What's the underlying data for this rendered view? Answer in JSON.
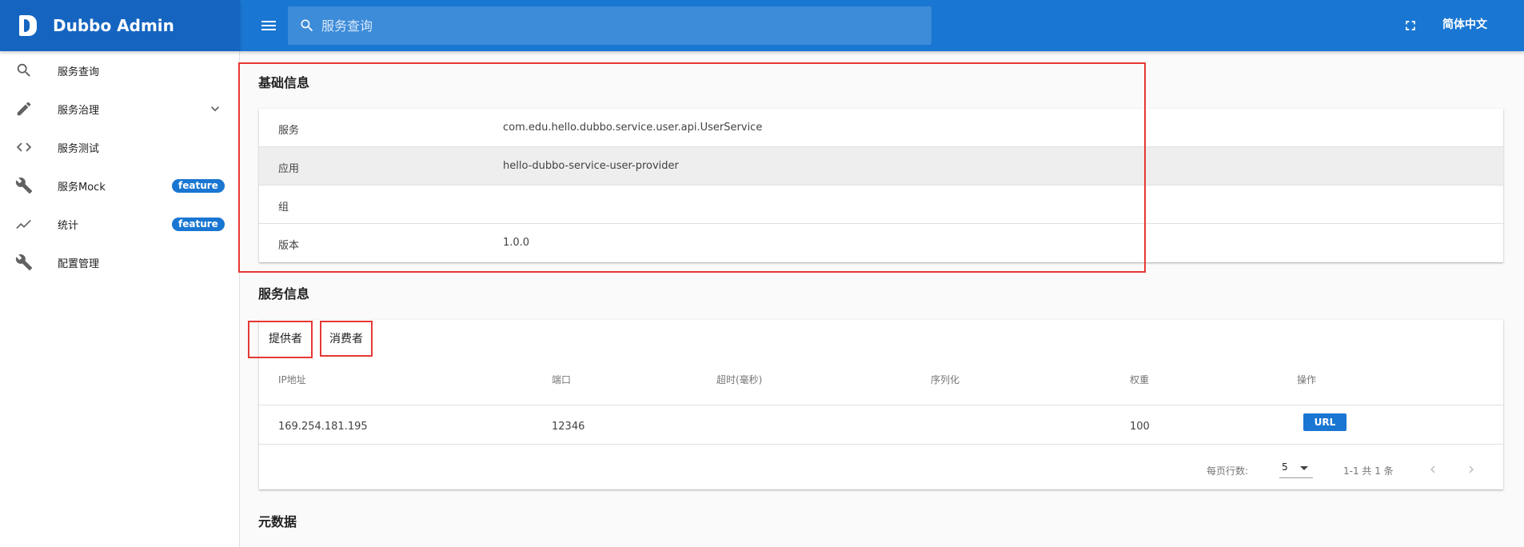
{
  "app": {
    "title": "Dubbo Admin"
  },
  "header": {
    "search_placeholder": "服务查询",
    "language_label": "简体中文",
    "icons": {
      "menu": "hamburger-menu-icon",
      "search": "search-icon",
      "fullscreen": "fullscreen-icon"
    }
  },
  "sidebar": {
    "items": [
      {
        "label": "服务查询",
        "icon": "search-icon"
      },
      {
        "label": "服务治理",
        "icon": "pencil-icon",
        "expandable": true
      },
      {
        "label": "服务测试",
        "icon": "code-icon"
      },
      {
        "label": "服务Mock",
        "icon": "wrench-icon",
        "badge": "feature"
      },
      {
        "label": "统计",
        "icon": "trending-line-icon",
        "badge": "feature"
      },
      {
        "label": "配置管理",
        "icon": "wrench-icon"
      }
    ]
  },
  "basic_info": {
    "title": "基础信息",
    "rows": [
      {
        "key": "服务",
        "value": "com.edu.hello.dubbo.service.user.api.UserService"
      },
      {
        "key": "应用",
        "value": "hello-dubbo-service-user-provider"
      },
      {
        "key": "组",
        "value": ""
      },
      {
        "key": "版本",
        "value": "1.0.0"
      }
    ]
  },
  "service_info": {
    "title": "服务信息",
    "tabs": [
      {
        "label": "提供者"
      },
      {
        "label": "消费者"
      }
    ],
    "columns": [
      "IP地址",
      "端口",
      "超时(毫秒)",
      "序列化",
      "权重",
      "操作"
    ],
    "rows": [
      {
        "ip": "169.254.181.195",
        "port": "12346",
        "timeout": "",
        "serialization": "",
        "weight": "100",
        "action": "URL"
      }
    ],
    "pagination": {
      "rows_per_page_label": "每页行数:",
      "rows_per_page": "5",
      "range_text": "1-1 共 1 条"
    }
  },
  "metadata": {
    "title": "元数据"
  },
  "colors": {
    "brand": "#1565c0",
    "topbar": "#1976d2",
    "badge": "#1976d2",
    "highlight": "#e53935"
  }
}
